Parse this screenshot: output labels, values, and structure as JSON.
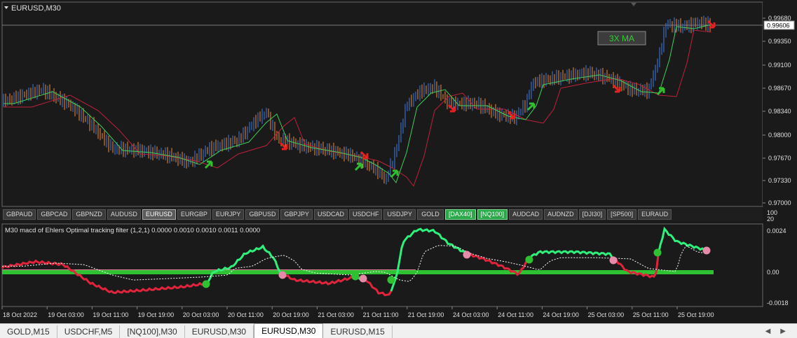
{
  "main_chart": {
    "title": "EURUSD,M30",
    "label": "3X MA",
    "current_price": "0.99606",
    "price_ticks": [
      "0.99680",
      "0.99350",
      "0.99100",
      "0.98670",
      "0.98340",
      "0.98000",
      "0.97670",
      "0.97330",
      "0.97000"
    ],
    "label_bg": "#3c3c3c",
    "label_color": "#33cc33"
  },
  "symbol_bar": {
    "buttons": [
      {
        "label": "GBPAUD",
        "state": "normal"
      },
      {
        "label": "GBPCAD",
        "state": "normal"
      },
      {
        "label": "GBPNZD",
        "state": "normal"
      },
      {
        "label": "AUDUSD",
        "state": "normal"
      },
      {
        "label": "EURUSD",
        "state": "active"
      },
      {
        "label": "EURGBP",
        "state": "normal"
      },
      {
        "label": "EURJPY",
        "state": "normal"
      },
      {
        "label": "GBPUSD",
        "state": "normal"
      },
      {
        "label": "GBPJPY",
        "state": "normal"
      },
      {
        "label": "USDCAD",
        "state": "normal"
      },
      {
        "label": "USDCHF",
        "state": "normal"
      },
      {
        "label": "USDJPY",
        "state": "normal"
      },
      {
        "label": "GOLD",
        "state": "normal"
      },
      {
        "label": "[DAX40]",
        "state": "green"
      },
      {
        "label": "[NQ100]",
        "state": "green"
      },
      {
        "label": "AUDCAD",
        "state": "normal"
      },
      {
        "label": "AUDNZD",
        "state": "normal"
      },
      {
        "label": "[DJI30]",
        "state": "normal"
      },
      {
        "label": "[SP500]",
        "state": "normal"
      },
      {
        "label": "EURAUD",
        "state": "normal"
      }
    ],
    "scale_labels": [
      "100",
      "20"
    ]
  },
  "indicator": {
    "title": "M30 macd of Ehlers Optimal tracking filter (1,2,1) 0.0000 0.0010 0.0010 0.0011 0.0000",
    "ticks": [
      "0.0024",
      "0.00",
      "-0.0018"
    ]
  },
  "time_axis": {
    "labels": [
      "18 Oct 2022",
      "19 Oct 03:00",
      "19 Oct 11:00",
      "19 Oct 19:00",
      "20 Oct 03:00",
      "20 Oct 11:00",
      "20 Oct 19:00",
      "21 Oct 03:00",
      "21 Oct 11:00",
      "21 Oct 19:00",
      "24 Oct 03:00",
      "24 Oct 11:00",
      "24 Oct 19:00",
      "25 Oct 03:00",
      "25 Oct 11:00",
      "25 Oct 19:00"
    ]
  },
  "tabs": [
    {
      "label": "GOLD,M15",
      "active": false
    },
    {
      "label": "USDCHF,M5",
      "active": false
    },
    {
      "label": "[NQ100],M30",
      "active": false
    },
    {
      "label": "EURUSD,M30",
      "active": false
    },
    {
      "label": "EURUSD,M30",
      "active": true
    },
    {
      "label": "EURUSD,M15",
      "active": false
    }
  ],
  "tab_arrows": [
    "◀",
    "▶"
  ],
  "colors": {
    "up_candle": "#3d7fe8",
    "down_candle": "#f58a2e",
    "ma_green": "#3ecf5a",
    "ma_red": "#c0213b",
    "zero_line": "#2ec233",
    "pink_band": "#e07a96",
    "macd_green": "#2ef07a",
    "macd_red": "#e0243c"
  }
}
